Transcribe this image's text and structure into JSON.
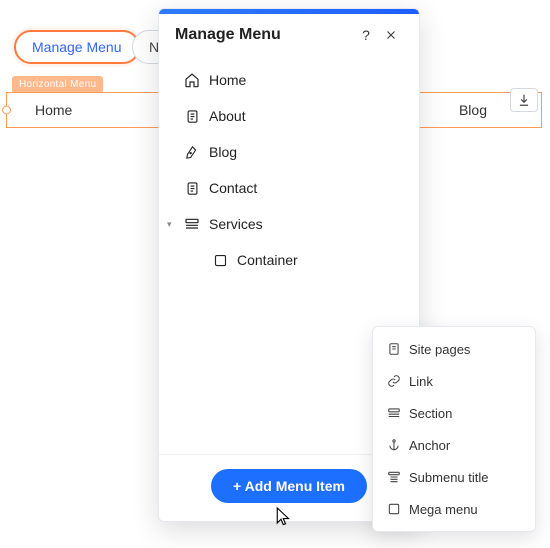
{
  "toolbar": {
    "manage_menu": "Manage Menu",
    "nav_label": "Na"
  },
  "tag_label": "Horizontal Menu",
  "menu_bar": {
    "item0": "Home",
    "item1": "Blog"
  },
  "panel": {
    "title": "Manage Menu",
    "rows": {
      "home": "Home",
      "about": "About",
      "blog": "Blog",
      "contact": "Contact",
      "services": "Services",
      "container": "Container"
    },
    "add_btn": "+ Add Menu Item"
  },
  "popup": {
    "site_pages": "Site pages",
    "link": "Link",
    "section": "Section",
    "anchor": "Anchor",
    "submenu": "Submenu title",
    "mega": "Mega menu"
  }
}
